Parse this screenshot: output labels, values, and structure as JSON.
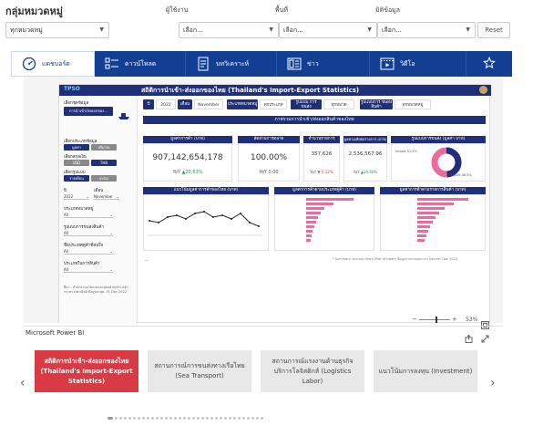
{
  "filters": {
    "category": {
      "label": "กลุ่มหมวดหมู่",
      "value": "ทุกหมวดหมู่"
    },
    "owner": {
      "label": "ผู้ใช้งาน",
      "value": "เลือก..."
    },
    "area": {
      "label": "พื้นที่",
      "value": "เลือก..."
    },
    "source": {
      "label": "มิติข้อมูล",
      "value": "เลือก..."
    },
    "reset_label": "Reset"
  },
  "tabs": [
    {
      "label": "แดชบอร์ด",
      "icon": "gauge-icon"
    },
    {
      "label": "ดาวน์โหลด",
      "icon": "list-icon"
    },
    {
      "label": "บทวิเคราะห์",
      "icon": "document-icon"
    },
    {
      "label": "ข่าว",
      "icon": "news-icon"
    },
    {
      "label": "วิดีโอ",
      "icon": "video-icon"
    },
    {
      "label": "",
      "icon": "star-icon"
    }
  ],
  "report": {
    "logo": "TPSO",
    "title": "สถิติการนำเข้า-ส่งออกของไทย (Thailand's Import-Export Statistics)",
    "left": {
      "select_data_label": "เลือกชุดข้อมูล",
      "select_data_value": "การนำเข้า/ส่งออกของ...",
      "type_label": "เลือกประเภทข้อมูล",
      "type_options": [
        "มูลค่า",
        "ปริมาณ"
      ],
      "currency_label": "เลือกสกุลเงิน",
      "currency_options": [
        "USD",
        "THB"
      ],
      "period_label": "เลือกรูปแบบ",
      "period_options": [
        "รายเดือน",
        "สะสม"
      ],
      "year_label": "ปี",
      "year_value": "2022",
      "month_label": "เดือน",
      "month_value": "November",
      "group_label": "ประเภทหมวดหมู่",
      "group_value": "All",
      "trade_label": "รูปแบบการขนส่งสินค้า",
      "trade_value": "All",
      "country_label": "ชื่อประเทศคู่ค้าที่สนใจ",
      "country_value": "All",
      "product_label": "ประเภทในการสินค้า",
      "product_value": "All",
      "footnote": "ที่มา : สำนักงานนโยบายและยุทธศาสตร์การค้า กระทรวงพาณิชย์ ข้อมูลล่าสุด: 31 Dec 2022"
    },
    "chips": [
      "ปี",
      "2022",
      "เดือน",
      "November",
      "ประเภทหมวดหมู่",
      "ทุกประเภท",
      "รูปแบบ การขนส่ง",
      "ทุกหมวด",
      "รูปแบบการ ขนส่งสินค้า",
      "ทุกหมวดหมู่"
    ],
    "banner": "ภาพรวมการนำเข้า/ส่งออกสินค้าของไทย",
    "kpis": [
      {
        "title": "มูลค่าการค้า (บาท)",
        "value": "907,142,654,178",
        "yoy_label": "YoY",
        "yoy": "▲20.63%",
        "dir": "up"
      },
      {
        "title": "สัดส่วนการตลาด",
        "value": "100.00%",
        "yoy_label": "YoY",
        "yoy": "0.00",
        "dir": "none"
      },
      {
        "title": "จำนวนรายการ",
        "value": "357,626",
        "yoy_label": "YoY",
        "yoy": "▼-0.12%",
        "dir": "down"
      },
      {
        "title": "มูลค่าเฉลี่ยต่อรายการ (บาท)",
        "value": "2,536,567.96",
        "yoy_label": "YoY",
        "yoy": "▲20.60%",
        "dir": "up"
      }
    ],
    "donut": {
      "title": "รูปแบบการขนส่ง (มูลค่า บาท)",
      "labels": [
        "Import 51.5%",
        "Export 48.5%"
      ]
    },
    "line_title": "แนวโน้มมูลค่าการค้าของไทย (บาท)",
    "bar1_title": "มูลค่าการค้าตามประเภทคู่ค้า (บาท)",
    "bar2_title": "มูลค่าการค้าตามรายการสินค้า (บาท)",
    "note": "* Summary: Annual chart (Part of trade) ข้อมูลจากกรมศุลกากร Source: Dec 2022",
    "dash": "--"
  },
  "pbi": {
    "name": "Microsoft Power BI",
    "zoom": "53%",
    "zoom_fraction": 0.53
  },
  "carousel": [
    {
      "line1": "สถิติการนำเข้า-ส่งออกของไทย",
      "line2": "(Thailand's Import-Export Statistics)",
      "active": true
    },
    {
      "line1": "สถานการณ์การขนส่งทางเรือไทย",
      "line2": "(Sea Transport)",
      "active": false
    },
    {
      "line1": "สถานการณ์แรงงานด้านธุรกิจ",
      "line2": "บริการโลจิสติกส์ (Logistics Labor)",
      "active": false
    },
    {
      "line1": "แนวโน้มการลงทุน (Investment)",
      "line2": "",
      "active": false
    }
  ],
  "carousel_total": 34,
  "carousel_current": 0
}
